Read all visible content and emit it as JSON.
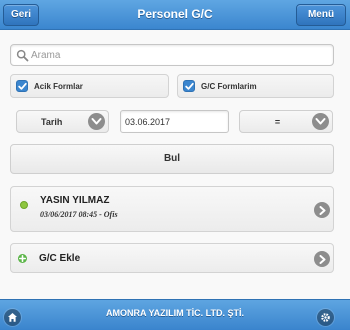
{
  "header": {
    "back_label": "Geri",
    "title": "Personel G/C",
    "menu_label": "Menü"
  },
  "search": {
    "placeholder": "Arama",
    "value": ""
  },
  "filters": {
    "open_forms_label": "Acik Formlar",
    "open_forms_checked": true,
    "my_forms_label": "G/C Formlarim",
    "my_forms_checked": true
  },
  "date_filter": {
    "field_label": "Tarih",
    "date_value": "03.06.2017",
    "operator_label": "="
  },
  "find_button_label": "Bul",
  "records": [
    {
      "name": "YASIN YILMAZ",
      "detail": "03/06/2017 08:45 - Ofis",
      "status_color": "#8ec63f"
    }
  ],
  "add_label": "G/C Ekle",
  "footer": {
    "company": "AMONRA YAZILIM TİC. LTD. ŞTİ."
  },
  "colors": {
    "accent": "#3b86cf",
    "status_ok": "#8ec63f",
    "add": "#5bb548"
  }
}
